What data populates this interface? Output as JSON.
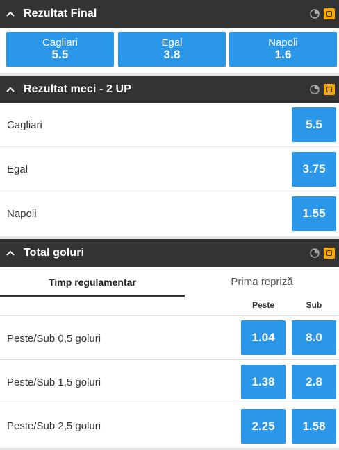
{
  "sections": {
    "final": {
      "title": "Rezultat Final"
    },
    "two_up": {
      "title": "Rezultat meci - 2 UP"
    },
    "total": {
      "title": "Total goluri"
    }
  },
  "final_result": [
    {
      "label": "Cagliari",
      "odd": "5.5"
    },
    {
      "label": "Egal",
      "odd": "3.8"
    },
    {
      "label": "Napoli",
      "odd": "1.6"
    }
  ],
  "two_up_rows": [
    {
      "label": "Cagliari",
      "odd": "5.5"
    },
    {
      "label": "Egal",
      "odd": "3.75"
    },
    {
      "label": "Napoli",
      "odd": "1.55"
    }
  ],
  "total_goals": {
    "tabs": [
      "Timp regulamentar",
      "Prima repriză"
    ],
    "active_tab": "Timp regulamentar",
    "columns": [
      "Peste",
      "Sub"
    ],
    "rows": [
      {
        "label": "Peste/Sub 0,5 goluri",
        "over": "1.04",
        "under": "8.0"
      },
      {
        "label": "Peste/Sub 1,5 goluri",
        "over": "1.38",
        "under": "2.8"
      },
      {
        "label": "Peste/Sub 2,5 goluri",
        "over": "2.25",
        "under": "1.58"
      }
    ]
  },
  "colors": {
    "header_bg": "#333333",
    "odd_button": "#2b97e8",
    "live_icon": "#f7a800"
  },
  "icons": [
    "chevron-up-icon",
    "stats-icon",
    "live-icon"
  ]
}
